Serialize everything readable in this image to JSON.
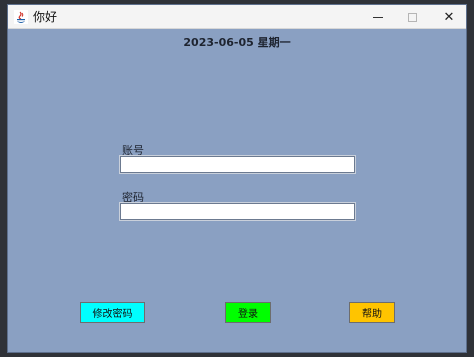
{
  "window": {
    "title": "你好",
    "icon": "java-app-icon",
    "controls": [
      "minimize-icon",
      "maximize-icon",
      "close-icon"
    ],
    "close_glyph": "✕"
  },
  "date_text": "2023-06-05 星期一",
  "form": {
    "account_label": "账号",
    "account_value": "",
    "password_label": "密码",
    "password_value": ""
  },
  "buttons": {
    "change_password": "修改密码",
    "login": "登录",
    "help": "帮助"
  },
  "colors": {
    "background": "#8aa0c2",
    "change_password_button": "#00ffff",
    "login_button": "#00ff00",
    "help_button": "#ffc400"
  }
}
